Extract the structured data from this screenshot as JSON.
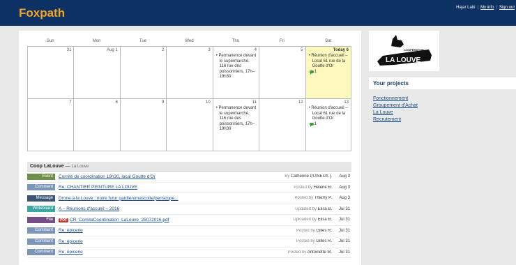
{
  "app": {
    "name": "Foxpath",
    "user": "Hajar Labi",
    "my_info": "My info",
    "sign_out": "Sign out",
    "sep": "|"
  },
  "calendar": {
    "days": [
      "Sun",
      "Mon",
      "Tue",
      "Wed",
      "Thu",
      "Fri",
      "Sat"
    ],
    "week1": [
      "31",
      "Aug 1",
      "2",
      "3",
      "4",
      "5",
      "Today 6"
    ],
    "week2": [
      "7",
      "8",
      "9",
      "10",
      "11",
      "12",
      "13"
    ],
    "events": {
      "permanence": "Permanence devant le supermarché, 116 rue des poissonniers, 17h–19h30",
      "reunion": "Réunion d'accueil – Local 61 rue de la Goutte d'Or",
      "comment_count": "1"
    }
  },
  "activity": {
    "project": "Coop LaLouve",
    "dash": "—",
    "client": "La Louve",
    "rows": [
      {
        "type": "Event",
        "title": "Comité de coordination 19h30, local Goutte d'Or",
        "by_prefix": "By",
        "who": "Catherine PUISEUX [.",
        "date": "Aug 3"
      },
      {
        "type": "Comment",
        "title": "Re: CHANTIER PEINTURE LA LOUVE",
        "by_prefix": "Posted by",
        "who": "Helene B.",
        "date": "Aug 3"
      },
      {
        "type": "Message",
        "title": "Drone à la Louve : notre futur gardien/mascotte/periscope...",
        "by_prefix": "Posted by",
        "who": "Thierry P.",
        "date": "Aug 3"
      },
      {
        "type": "Writeboard",
        "title": "A – Réunions d'accueil – 2016",
        "by_prefix": "Updated by",
        "who": "Elisa B.",
        "date": "Jul 31"
      },
      {
        "type": "File",
        "pdf": "PDF",
        "title": "CR_ComiteCoordination_LaLouve_25072016.pdf",
        "by_prefix": "Uploaded by",
        "who": "Elisa B.",
        "date": "Jul 31"
      },
      {
        "type": "Comment",
        "title": "Re: épicerie",
        "by_prefix": "Posted by",
        "who": "Gilles R.",
        "date": "Jul 31"
      },
      {
        "type": "Comment",
        "title": "Re: épicerie",
        "by_prefix": "Posted by",
        "who": "Gilles R.",
        "date": "Jul 31"
      },
      {
        "type": "Comment",
        "title": "Re: épicerie",
        "by_prefix": "Posted by",
        "who": "Antoinette M.",
        "date": "Jul 31"
      }
    ]
  },
  "sidebar": {
    "logo_small": "COOPÉRATIVE",
    "logo_big": "LA LOUVE",
    "heading": "Your projects",
    "projects": [
      "Fonctionnement",
      "Groupement d'Achat",
      "La Louve",
      "Recrutement"
    ]
  },
  "colors": {
    "topbar": "#0d3163",
    "brand": "#f5a623",
    "today": "#fdf8bd",
    "event": "#6f8f4a",
    "comment": "#7a95b5",
    "message": "#3c5372",
    "writeboard": "#3aa7a0",
    "file": "#754e86"
  }
}
